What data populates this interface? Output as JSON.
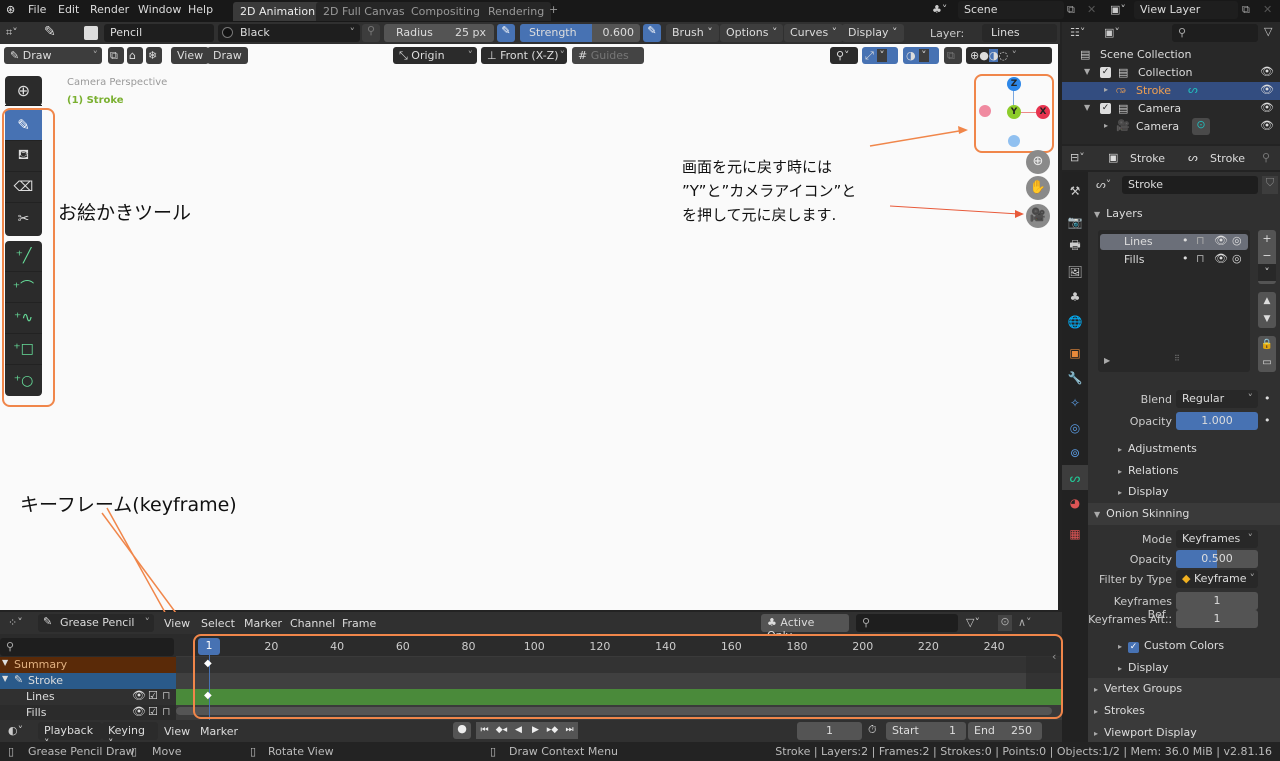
{
  "topbar": {
    "menus": [
      "File",
      "Edit",
      "Render",
      "Window",
      "Help"
    ],
    "workspaces": [
      "2D Animation",
      "2D Full Canvas",
      "Compositing",
      "Rendering"
    ],
    "add_workspace": "+",
    "scene": "Scene",
    "view_layer": "View Layer"
  },
  "toolheader": {
    "brush_name": "Pencil",
    "material": "Black",
    "radius_label": "Radius",
    "radius_value": "25 px",
    "strength_label": "Strength",
    "strength_value": "0.600",
    "menus": [
      "Brush",
      "Options",
      "Curves",
      "Display"
    ],
    "layer_label": "Layer:",
    "layer_value": "Lines"
  },
  "viewport": {
    "mode": "Draw",
    "view_menu": "View",
    "draw_menu": "Draw",
    "origin": "Origin",
    "orientation": "Front (X-Z)",
    "guides": "Guides",
    "camera_text": "Camera Perspective",
    "object_text": "(1) Stroke",
    "gizmo": {
      "z": "Z",
      "y": "Y",
      "x": "X"
    }
  },
  "annotations": {
    "tools_label": "お絵かきツール",
    "reset_line1": "画面を元に戻す時には",
    "reset_line2": "”Y”と”カメラアイコン”と",
    "reset_line3": "を押して元に戻します.",
    "keyframe_label": "キーフレーム(keyframe)",
    "accent_color": "#f0864a"
  },
  "outliner": {
    "search_placeholder": "",
    "scene_collection": "Scene Collection",
    "items": [
      {
        "label": "Collection",
        "level": 1
      },
      {
        "label": "Stroke",
        "level": 2,
        "selected": true
      },
      {
        "label": "Camera",
        "level": 1
      },
      {
        "label": "Camera",
        "level": 2
      }
    ]
  },
  "properties": {
    "breadcrumb_object": "Stroke",
    "breadcrumb_data": "Stroke",
    "data_name": "Stroke",
    "layers_title": "Layers",
    "layers": [
      "Lines",
      "Fills"
    ],
    "blend_label": "Blend",
    "blend_value": "Regular",
    "opacity_label": "Opacity",
    "opacity_value": "1.000",
    "adjustments": "Adjustments",
    "relations": "Relations",
    "display": "Display",
    "onion_title": "Onion Skinning",
    "mode_label": "Mode",
    "mode_value": "Keyframes",
    "onion_opacity_label": "Opacity",
    "onion_opacity_value": "0.500",
    "filter_label": "Filter by Type",
    "filter_value": "Keyframe",
    "kf_before_label": "Keyframes Bef..",
    "kf_before_value": "1",
    "kf_after_label": "Keyframes Aft..",
    "kf_after_value": "1",
    "custom_colors": "Custom Colors",
    "display2": "Display",
    "vertex_groups": "Vertex Groups",
    "strokes": "Strokes",
    "viewport_display": "Viewport Display"
  },
  "dopesheet": {
    "mode": "Grease Pencil",
    "menus": [
      "View",
      "Select",
      "Marker",
      "Channel",
      "Frame"
    ],
    "active_only": "Active Only",
    "current_frame": "1",
    "ticks": [
      "20",
      "40",
      "60",
      "80",
      "100",
      "120",
      "140",
      "160",
      "180",
      "200",
      "220",
      "240"
    ],
    "channels": [
      {
        "label": "Summary"
      },
      {
        "label": "Stroke"
      },
      {
        "label": "Lines"
      },
      {
        "label": "Fills"
      }
    ]
  },
  "timeline": {
    "menus": [
      "Playback",
      "Keying",
      "View",
      "Marker"
    ],
    "frame": "1",
    "start_label": "Start",
    "start_value": "1",
    "end_label": "End",
    "end_value": "250"
  },
  "statusbar": {
    "hint1": "Grease Pencil Draw",
    "hint2": "Move",
    "hint3": "Rotate View",
    "hint4": "Draw Context Menu",
    "stats": "Stroke | Layers:2 | Frames:2 | Strokes:0 | Points:0 | Objects:1/2 | Mem: 36.0 MiB | v2.81.16"
  }
}
